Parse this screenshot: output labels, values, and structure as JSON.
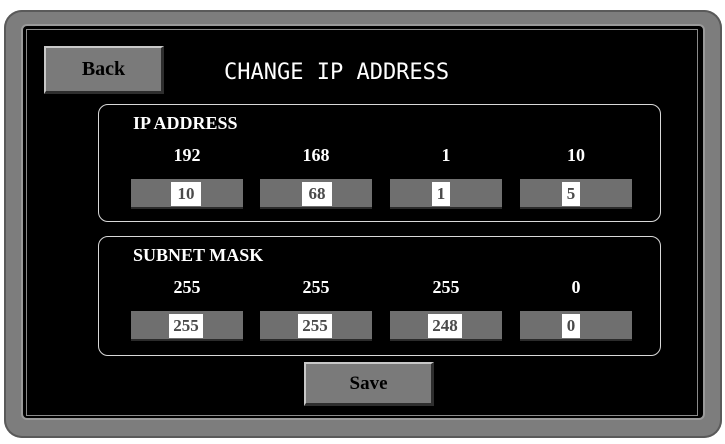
{
  "header": {
    "back_label": "Back",
    "title": "CHANGE IP ADDRESS"
  },
  "ip_address": {
    "label": "IP ADDRESS",
    "current": [
      "192",
      "168",
      "1",
      "10"
    ],
    "inputs": [
      "10",
      "68",
      "1",
      "5"
    ]
  },
  "subnet_mask": {
    "label": "SUBNET MASK",
    "current": [
      "255",
      "255",
      "255",
      "0"
    ],
    "inputs": [
      "255",
      "255",
      "248",
      "0"
    ]
  },
  "footer": {
    "save_label": "Save"
  },
  "colors": {
    "panel_bg": "#000000",
    "bezel": "#7d7d7d",
    "button_face": "#7a7a7a",
    "field_bg": "#6f6f6f",
    "text": "#ffffff"
  }
}
